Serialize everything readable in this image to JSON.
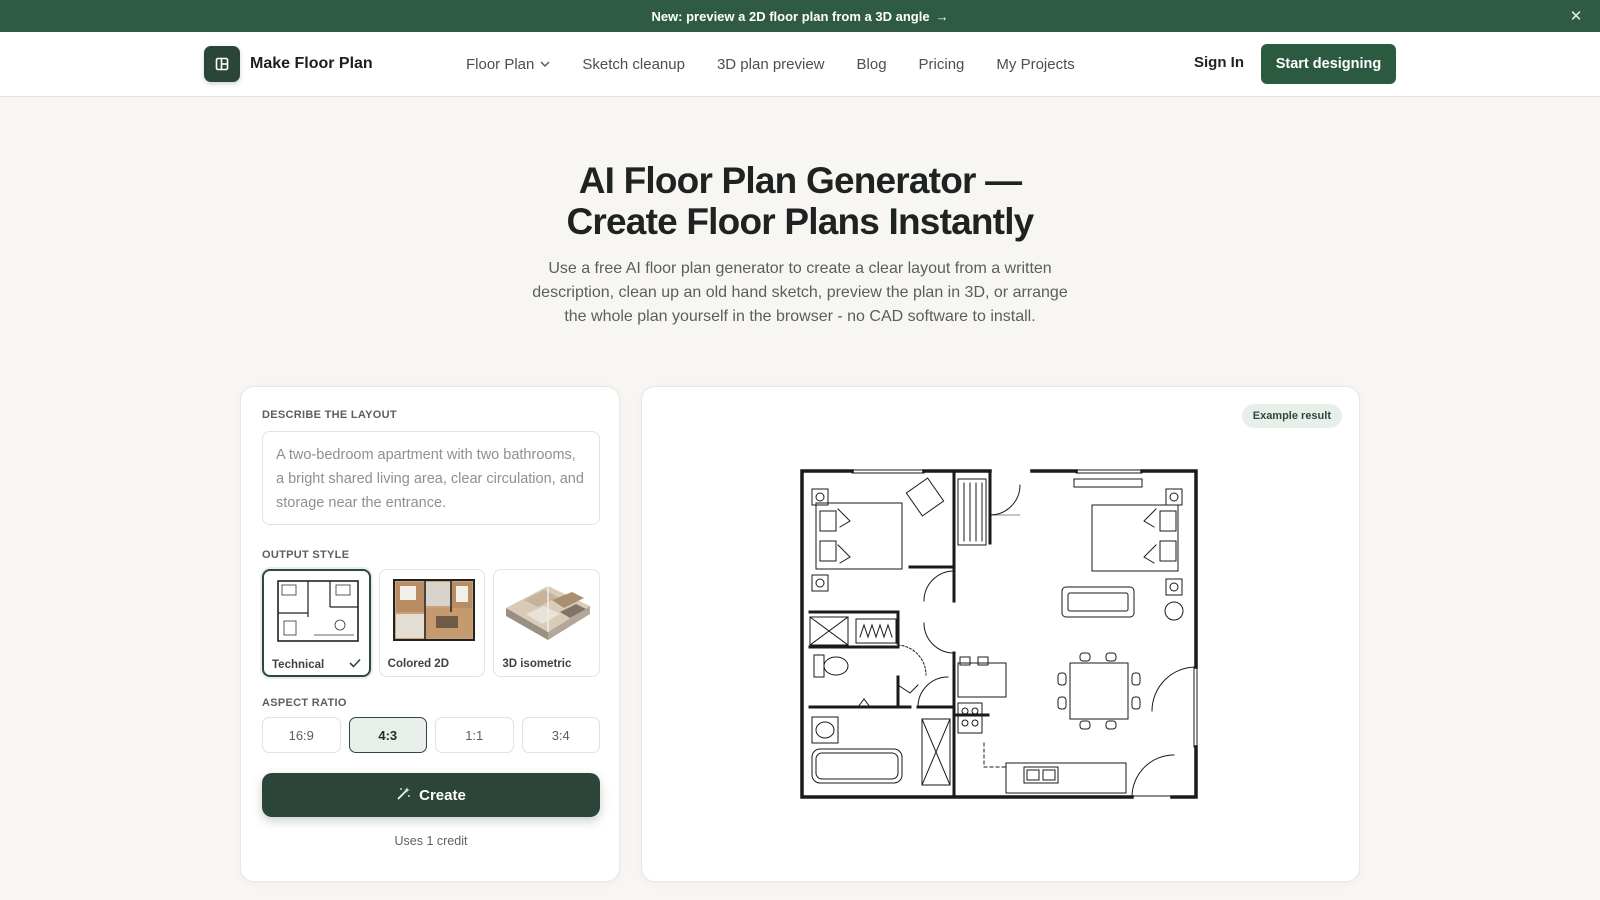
{
  "announcement": {
    "text": "New: preview a 2D floor plan from a 3D angle",
    "arrow": "→",
    "close": "✕"
  },
  "nav": {
    "brand": "Make Floor Plan",
    "links": [
      "Floor Plan",
      "Sketch cleanup",
      "3D plan preview",
      "Blog",
      "Pricing",
      "My Projects"
    ],
    "sign_in": "Sign In",
    "cta": "Start designing"
  },
  "hero": {
    "title_line1": "AI Floor Plan Generator —",
    "title_line2": "Create Floor Plans Instantly",
    "subtitle": "Use a free AI floor plan generator to create a clear layout from a written description, clean up an old hand sketch, preview the plan in 3D, or arrange the whole plan yourself in the browser - no CAD software to install."
  },
  "form": {
    "describe_label": "DESCRIBE THE LAYOUT",
    "describe_placeholder": "A two-bedroom apartment with two bathrooms, a bright shared living area, clear circulation, and storage near the entrance.",
    "output_label": "OUTPUT STYLE",
    "styles": [
      {
        "label": "Technical",
        "selected": true
      },
      {
        "label": "Colored 2D",
        "selected": false
      },
      {
        "label": "3D isometric",
        "selected": false
      }
    ],
    "aspect_label": "ASPECT RATIO",
    "ratios": [
      {
        "label": "16:9",
        "selected": false
      },
      {
        "label": "4:3",
        "selected": true
      },
      {
        "label": "1:1",
        "selected": false
      },
      {
        "label": "3:4",
        "selected": false
      }
    ],
    "create_label": "Create",
    "credit_note": "Uses 1 credit"
  },
  "preview": {
    "badge": "Example result"
  },
  "colors": {
    "brand_green": "#2b4639",
    "announce_green": "#2f5b44",
    "background": "#f7f6f3"
  }
}
